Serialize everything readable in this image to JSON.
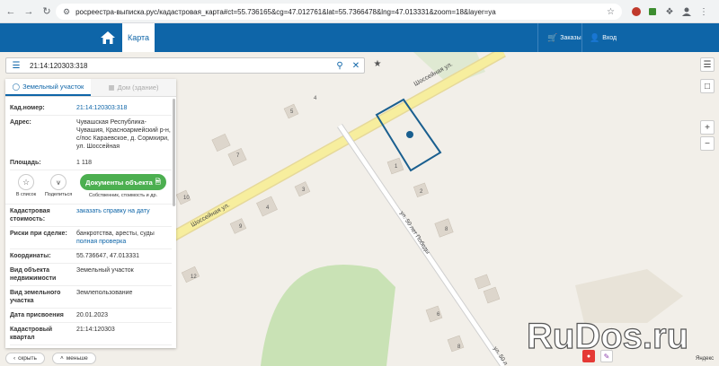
{
  "browser": {
    "url": "росреестра-выписка.рус/кадастровая_карта#ct=55.736165&cg=47.012761&lat=55.7366478&lng=47.013331&zoom=18&layer=ya"
  },
  "header": {
    "map_tab": "Карта",
    "orders": "Заказы",
    "login": "Вход"
  },
  "search": {
    "query": "21:14:120303:318"
  },
  "panel": {
    "tab_land": "Земельный участок",
    "tab_house": "Дом (здание)",
    "cad_number_label": "Кад.номер:",
    "cad_number": "21:14:120303:318",
    "address_label": "Адрес:",
    "address": "Чувашская Республика- Чувашия, Красноармейский р-н, с/пос Караевское, д. Сормхири, ул. Шоссейная",
    "area_label": "Площадь:",
    "area": "1 118",
    "to_list": "В список",
    "share": "Поделиться",
    "docs_button": "Документы объекта",
    "docs_sub": "Собственник, стоимость и др.",
    "cad_value_label": "Кадастровая стоимость:",
    "cad_value": "заказать справку на дату",
    "risks_label": "Риски при сделке:",
    "risks": "банкротства, аресты, суды",
    "risks_link": "полная проверка",
    "coords_label": "Координаты:",
    "coords": "55.736647, 47.013331",
    "object_type_label": "Вид объекта недвижимости",
    "object_type": "Земельный участок",
    "land_type_label": "Вид земельного участка",
    "land_type": "Землепользование",
    "date_label": "Дата присвоения",
    "date": "20.01.2023",
    "quarter_label": "Кадастровый квартал",
    "quarter": "21:14:120303"
  },
  "bottom": {
    "hide": "скрыть",
    "less": "меньше"
  },
  "map": {
    "street_main": "Шоссейная ул.",
    "street_main2": "Шоссейная ул.",
    "street_side": "ул. 50 лет Победы",
    "street_side2": "ул. 50 л",
    "house_numbers": [
      "4",
      "5",
      "7",
      "1",
      "2",
      "3",
      "4",
      "8",
      "9",
      "10",
      "12",
      "6",
      "8"
    ],
    "provider": "Яндекс"
  },
  "watermark": {
    "text": "RuDos.ru"
  },
  "colors": {
    "header": "#0e65a8",
    "parcel": "#1a5f8f",
    "road": "#f7e98c",
    "green": "#b9d9a5",
    "docs_button": "#4caf50"
  }
}
